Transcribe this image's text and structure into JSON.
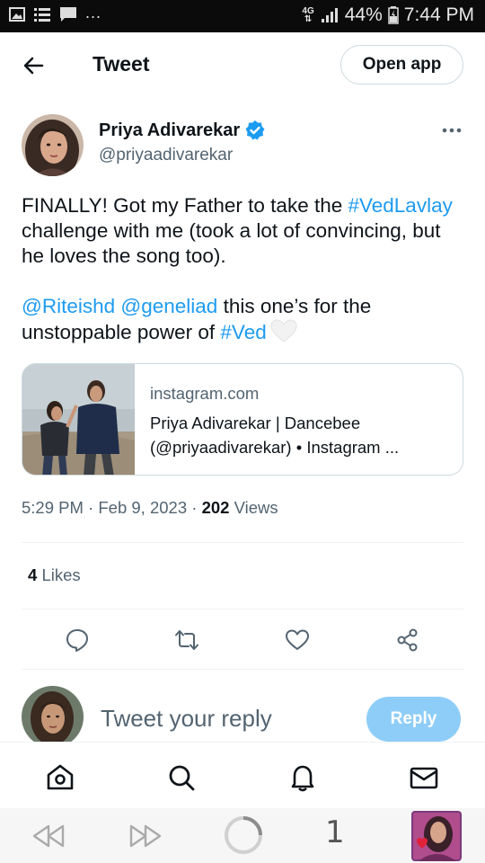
{
  "status_bar": {
    "left_icons": [
      "image-icon",
      "list-icon",
      "chat-icon"
    ],
    "overflow": "...",
    "network": "4G",
    "battery": "44%",
    "time": "7:44 PM"
  },
  "header": {
    "title": "Tweet",
    "open_app_label": "Open app"
  },
  "tweet": {
    "author": {
      "name": "Priya Adivarekar",
      "handle": "@priyaadivarekar",
      "verified": true
    },
    "text": {
      "p1_a": "FINALLY! Got my Father to take the ",
      "p1_hashtag": "#VedLavlay",
      "p1_b": " challenge with me (took a lot of convincing, but he loves the song too).",
      "p2_mention1": "@Riteishd",
      "p2_space": " ",
      "p2_mention2": "@geneliad",
      "p2_a": " this one’s for the unstoppable power of ",
      "p2_hashtag": "#Ved",
      "emoji": "white-heart"
    },
    "card": {
      "domain": "instagram.com",
      "title": "Priya Adivarekar | Dancebee (@priyaadivarekar) • Instagram ..."
    },
    "time": "5:29 PM",
    "date": "Feb 9, 2023",
    "views_count": "202",
    "views_label": "Views",
    "likes_count": "4",
    "likes_label": "Likes"
  },
  "actions": [
    "reply-icon",
    "retweet-icon",
    "like-icon",
    "share-icon"
  ],
  "reply_box": {
    "placeholder": "Tweet your reply",
    "button_label": "Reply"
  },
  "bottom_nav": [
    "home-icon",
    "search-icon",
    "notifications-icon",
    "messages-icon"
  ],
  "browser_bar": {
    "tab_count": "1"
  },
  "colors": {
    "accent": "#1d9bf0",
    "reply_button": "#8ecdf8",
    "secondary_text": "#536471",
    "status_bar": "#0b0b0b"
  }
}
